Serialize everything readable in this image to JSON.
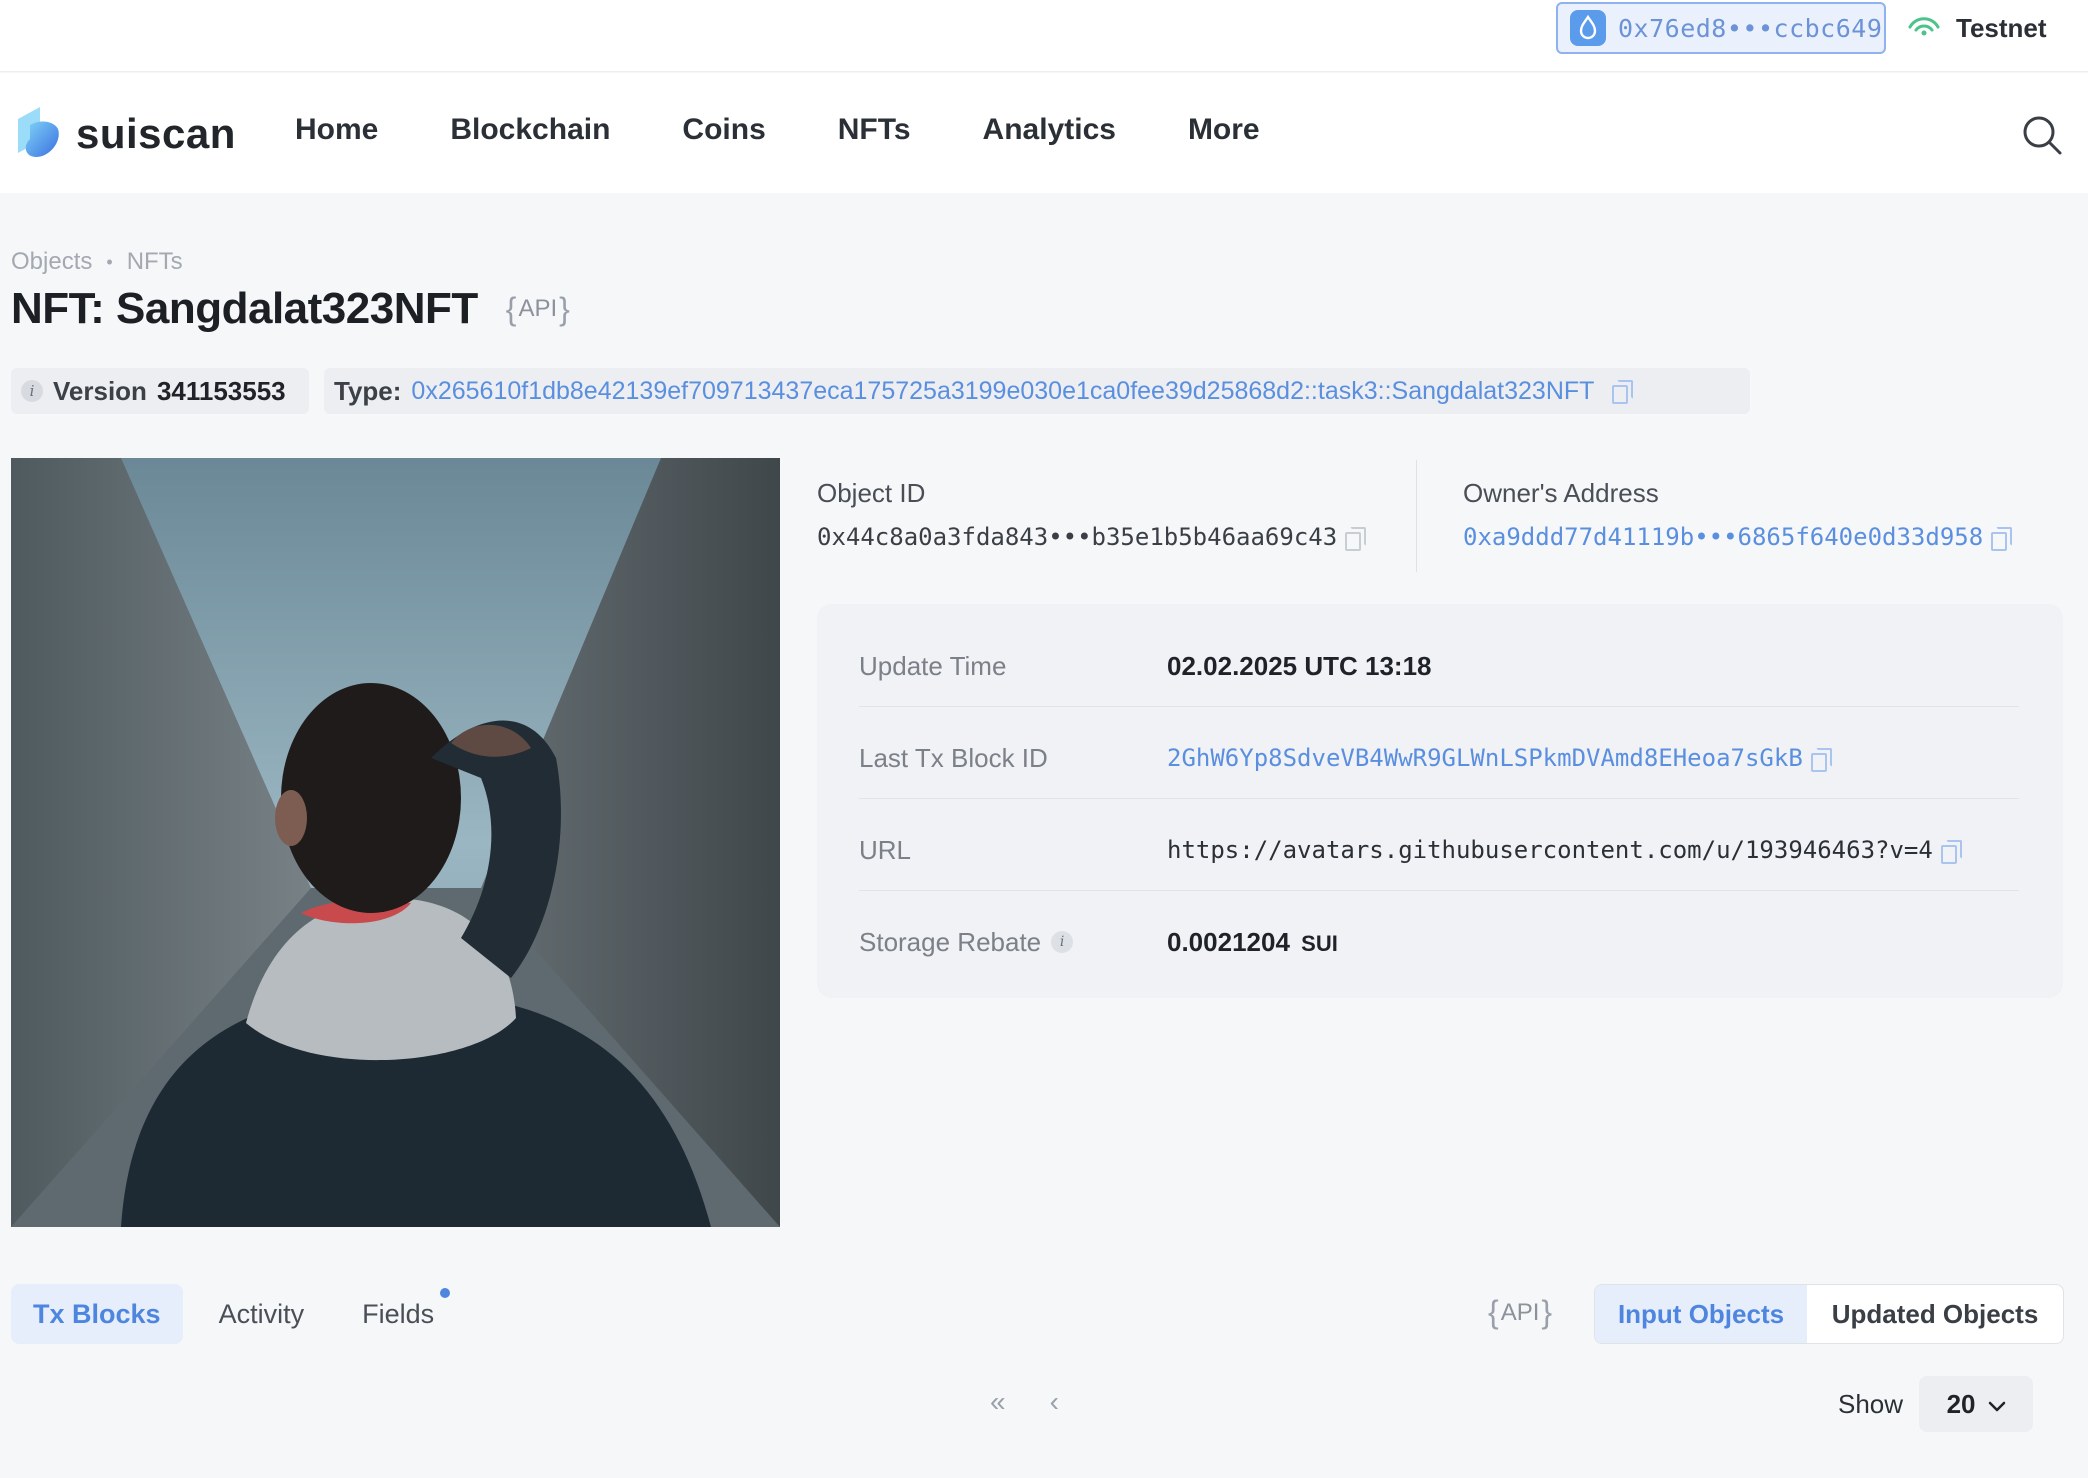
{
  "wallet": {
    "address": "0x76ed8•••ccbc649"
  },
  "network": {
    "label": "Testnet"
  },
  "brand": {
    "name": "suiscan"
  },
  "nav": {
    "items": [
      "Home",
      "Blockchain",
      "Coins",
      "NFTs",
      "Analytics",
      "More"
    ]
  },
  "breadcrumb": {
    "items": [
      "Objects",
      "NFTs"
    ],
    "separator": "•"
  },
  "page": {
    "title": "NFT: Sangdalat323NFT",
    "api_label": "API"
  },
  "chips": {
    "version_label": "Version",
    "version_value": "341153553",
    "type_label": "Type:",
    "type_value": "0x265610f1db8e42139ef709713437eca175725a3199e030e1ca0fee39d25868d2::task3::Sangdalat323NFT"
  },
  "object_id": {
    "label": "Object ID",
    "value": "0x44c8a0a3fda843•••b35e1b5b46aa69c43"
  },
  "owner": {
    "label": "Owner's Address",
    "value": "0xa9ddd77d41119b•••6865f640e0d33d958"
  },
  "details": {
    "update_time": {
      "label": "Update Time",
      "value": "02.02.2025 UTC 13:18"
    },
    "last_tx": {
      "label": "Last Tx Block ID",
      "value": "2GhW6Yp8SdveVB4WwR9GLWnLSPkmDVAmd8EHeoa7sGkB"
    },
    "url": {
      "label": "URL",
      "value": "https://avatars.githubusercontent.com/u/193946463?v=4"
    },
    "storage_rebate": {
      "label": "Storage Rebate",
      "value": "0.0021204",
      "unit": "SUI"
    }
  },
  "tabs": {
    "items": [
      "Tx Blocks",
      "Activity",
      "Fields"
    ],
    "active": "Tx Blocks"
  },
  "bottom": {
    "api_label": "API",
    "segment": {
      "input": "Input Objects",
      "updated": "Updated Objects"
    },
    "pager": {
      "first": "«",
      "prev": "‹"
    },
    "show_label": "Show",
    "show_value": "20"
  },
  "colors": {
    "accent": "#4e86df",
    "link": "#5a8fe0",
    "testnet": "#4cc38a"
  }
}
